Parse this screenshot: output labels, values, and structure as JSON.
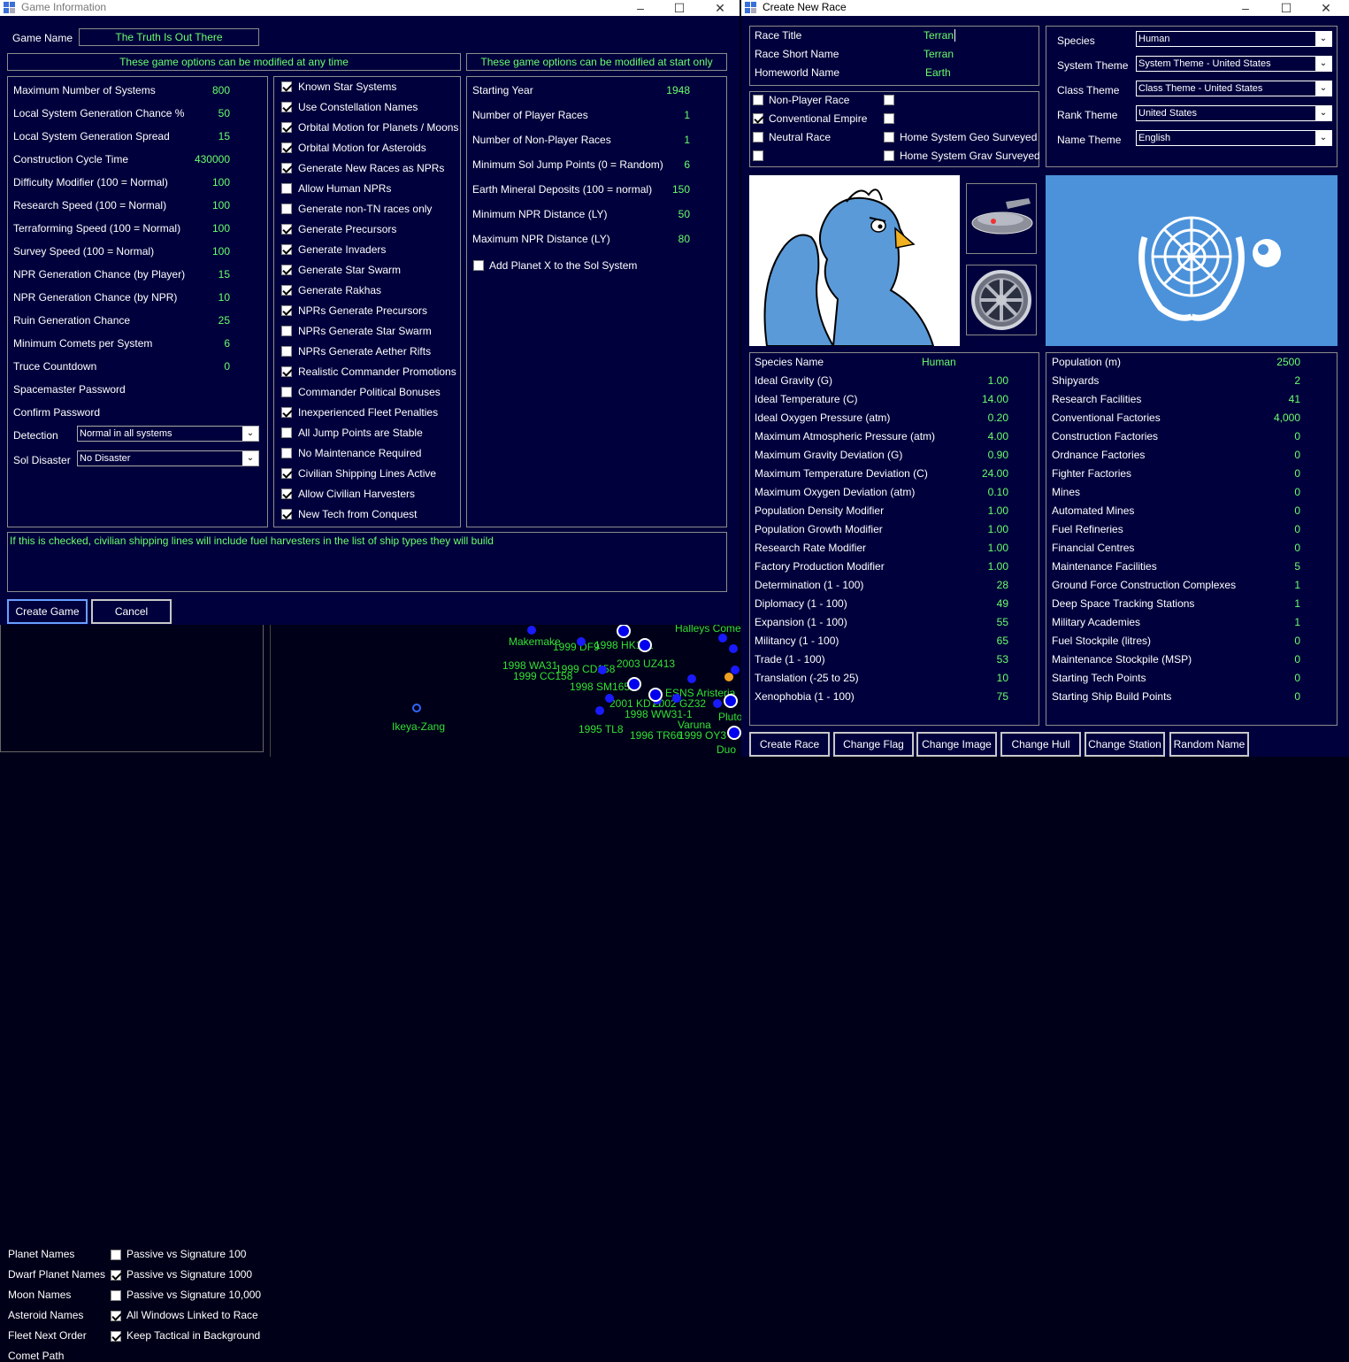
{
  "game_window": {
    "title": "Game Information",
    "game_name_label": "Game Name",
    "game_name_value": "The Truth Is Out There",
    "header_any_time": "These game options can be modified at any time",
    "header_start_only": "These game options can be modified at start only",
    "numeric_options": [
      {
        "label": "Maximum Number of Systems",
        "value": "800"
      },
      {
        "label": "Local System Generation Chance %",
        "value": "50"
      },
      {
        "label": "Local System Generation Spread",
        "value": "15"
      },
      {
        "label": "Construction Cycle Time",
        "value": "430000"
      },
      {
        "label": "Difficulty Modifier  (100 = Normal)",
        "value": "100"
      },
      {
        "label": "Research Speed  (100 = Normal)",
        "value": "100"
      },
      {
        "label": "Terraforming Speed  (100 = Normal)",
        "value": "100"
      },
      {
        "label": "Survey Speed  (100 = Normal)",
        "value": "100"
      },
      {
        "label": "NPR Generation Chance (by Player)",
        "value": "15"
      },
      {
        "label": "NPR Generation Chance (by NPR)",
        "value": "10"
      },
      {
        "label": "Ruin Generation Chance",
        "value": "25"
      },
      {
        "label": "Minimum Comets per System",
        "value": "6"
      },
      {
        "label": "Truce Countdown",
        "value": "0"
      },
      {
        "label": "Spacemaster Password",
        "value": ""
      },
      {
        "label": "Confirm Password",
        "value": ""
      }
    ],
    "detection_label": "Detection",
    "detection_value": "Normal in all systems",
    "sol_disaster_label": "Sol Disaster",
    "sol_disaster_value": "No Disaster",
    "checkbox_options": [
      {
        "label": "Known Star Systems",
        "checked": true
      },
      {
        "label": "Use Constellation Names",
        "checked": true
      },
      {
        "label": "Orbital Motion for Planets / Moons",
        "checked": true
      },
      {
        "label": "Orbital Motion for Asteroids",
        "checked": true
      },
      {
        "label": "Generate New Races as NPRs",
        "checked": true
      },
      {
        "label": "Allow Human NPRs",
        "checked": false
      },
      {
        "label": "Generate non-TN races only",
        "checked": false
      },
      {
        "label": "Generate Precursors",
        "checked": true
      },
      {
        "label": "Generate Invaders",
        "checked": true
      },
      {
        "label": "Generate Star Swarm",
        "checked": true
      },
      {
        "label": "Generate Rakhas",
        "checked": true
      },
      {
        "label": "NPRs Generate Precursors",
        "checked": true
      },
      {
        "label": "NPRs Generate Star Swarm",
        "checked": false
      },
      {
        "label": "NPRs Generate Aether Rifts",
        "checked": false
      },
      {
        "label": "Realistic Commander Promotions",
        "checked": true
      },
      {
        "label": "Commander Political Bonuses",
        "checked": false
      },
      {
        "label": "Inexperienced Fleet Penalties",
        "checked": true
      },
      {
        "label": "All Jump Points are Stable",
        "checked": false
      },
      {
        "label": "No Maintenance Required",
        "checked": false
      },
      {
        "label": "Civilian Shipping Lines Active",
        "checked": true
      },
      {
        "label": "Allow Civilian Harvesters",
        "checked": true
      },
      {
        "label": "New Tech from Conquest",
        "checked": true
      }
    ],
    "start_options": [
      {
        "label": "Starting Year",
        "value": "1948"
      },
      {
        "label": "Number of Player Races",
        "value": "1"
      },
      {
        "label": "Number of Non-Player Races",
        "value": "1"
      },
      {
        "label": "Minimum Sol Jump Points (0 = Random)",
        "value": "6"
      },
      {
        "label": "Earth Mineral Deposits  (100 = normal)",
        "value": "150"
      },
      {
        "label": "Minimum NPR Distance (LY)",
        "value": "50"
      },
      {
        "label": "Maximum NPR Distance (LY)",
        "value": "80"
      }
    ],
    "planet_x_label": "Add Planet X to the Sol System",
    "tooltip_text": "If this is checked, civilian shipping lines will include fuel harvesters in the list of ship types they will build",
    "create_button": "Create Game",
    "cancel_button": "Cancel"
  },
  "background": {
    "left_list": [
      "Planet Names",
      "Dwarf Planet Names",
      "Moon Names",
      "Asteroid Names",
      "Fleet Next Order",
      "Comet Path"
    ],
    "right_list": [
      {
        "label": "Passive vs Signature 100",
        "checked": false
      },
      {
        "label": "Passive vs Signature 1000",
        "checked": true
      },
      {
        "label": "Passive vs Signature 10,000",
        "checked": false
      },
      {
        "label": "All Windows Linked to Race",
        "checked": true
      },
      {
        "label": "Keep Tactical in Background",
        "checked": true
      }
    ],
    "map_labels": [
      "Makemake",
      "1999 DF9",
      "1998 HK151",
      "1998 WA31",
      "1999 CD158",
      "2003 UZ413",
      "1999 CC158",
      "1998 SM165",
      "2001 KD77",
      "2002 GZ32",
      "1998 WW31-1",
      "Varuna",
      "1996 TR66",
      "1999 OY3",
      "1995 TL8",
      "Ikeya-Zang",
      "Halleys Comet",
      "ESNS Aristeria",
      "Pluto",
      "Duo"
    ]
  },
  "race_window": {
    "title": "Create New Race",
    "race_title_label": "Race Title",
    "race_title_value": "Terran",
    "race_short_label": "Race Short Name",
    "race_short_value": "Terran",
    "homeworld_label": "Homeworld Name",
    "homeworld_value": "Earth",
    "themes": [
      {
        "label": "Species",
        "value": "Human"
      },
      {
        "label": "System Theme",
        "value": "System Theme - United States"
      },
      {
        "label": "Class Theme",
        "value": "Class Theme - United States"
      },
      {
        "label": "Rank Theme",
        "value": "United States"
      },
      {
        "label": "Name Theme",
        "value": "English"
      }
    ],
    "flags_left": [
      {
        "label": "Non-Player Race",
        "checked": false
      },
      {
        "label": "Conventional Empire",
        "checked": true
      },
      {
        "label": "Neutral Race",
        "checked": false
      },
      {
        "label": "",
        "checked": false
      }
    ],
    "flags_right": [
      {
        "label": "",
        "checked": false
      },
      {
        "label": "",
        "checked": false
      },
      {
        "label": "Home System Geo Surveyed",
        "checked": false
      },
      {
        "label": "Home System Grav Surveyed",
        "checked": false
      }
    ],
    "species_name_label": "Species Name",
    "species_name_value": "Human",
    "species_stats": [
      {
        "label": "Ideal Gravity (G)",
        "value": "1.00"
      },
      {
        "label": "Ideal Temperature (C)",
        "value": "14.00"
      },
      {
        "label": "Ideal Oxygen Pressure (atm)",
        "value": "0.20"
      },
      {
        "label": "Maximum Atmospheric Pressure (atm)",
        "value": "4.00"
      },
      {
        "label": "Maximum Gravity Deviation (G)",
        "value": "0.90"
      },
      {
        "label": "Maximum Temperature Deviation (C)",
        "value": "24.00"
      },
      {
        "label": "Maximum Oxygen Deviation (atm)",
        "value": "0.10"
      },
      {
        "label": "Population Density Modifier",
        "value": "1.00"
      },
      {
        "label": "Population Growth Modifier",
        "value": "1.00"
      },
      {
        "label": "Research Rate Modifier",
        "value": "1.00"
      },
      {
        "label": "Factory Production Modifier",
        "value": "1.00"
      },
      {
        "label": "Determination (1 - 100)",
        "value": "28"
      },
      {
        "label": "Diplomacy (1 - 100)",
        "value": "49"
      },
      {
        "label": "Expansion (1 - 100)",
        "value": "55"
      },
      {
        "label": "Militancy (1 - 100)",
        "value": "65"
      },
      {
        "label": "Trade (1 - 100)",
        "value": "53"
      },
      {
        "label": "Translation (-25 to 25)",
        "value": "10"
      },
      {
        "label": "Xenophobia (1 - 100)",
        "value": "75"
      }
    ],
    "colony_stats": [
      {
        "label": "Population (m)",
        "value": "2500"
      },
      {
        "label": "Shipyards",
        "value": "2"
      },
      {
        "label": "Research Facilities",
        "value": "41"
      },
      {
        "label": "Conventional Factories",
        "value": "4,000"
      },
      {
        "label": "Construction Factories",
        "value": "0"
      },
      {
        "label": "Ordnance Factories",
        "value": "0"
      },
      {
        "label": "Fighter Factories",
        "value": "0"
      },
      {
        "label": "Mines",
        "value": "0"
      },
      {
        "label": "Automated Mines",
        "value": "0"
      },
      {
        "label": "Fuel Refineries",
        "value": "0"
      },
      {
        "label": "Financial Centres",
        "value": "0"
      },
      {
        "label": "Maintenance Facilities",
        "value": "5"
      },
      {
        "label": "Ground Force Construction Complexes",
        "value": "1"
      },
      {
        "label": "Deep Space Tracking Stations",
        "value": "1"
      },
      {
        "label": "Military Academies",
        "value": "1"
      },
      {
        "label": "Fuel Stockpile (litres)",
        "value": "0"
      },
      {
        "label": "Maintenance Stockpile (MSP)",
        "value": "0"
      },
      {
        "label": "Starting Tech Points",
        "value": "0"
      },
      {
        "label": "Starting Ship Build Points",
        "value": "0"
      }
    ],
    "buttons": [
      "Create Race",
      "Change Flag",
      "Change Image",
      "Change Hull",
      "Change Station",
      "Random Name"
    ],
    "colors": {
      "flag_blue": "#4b92db",
      "alien_blue": "#5a9ad8"
    }
  }
}
